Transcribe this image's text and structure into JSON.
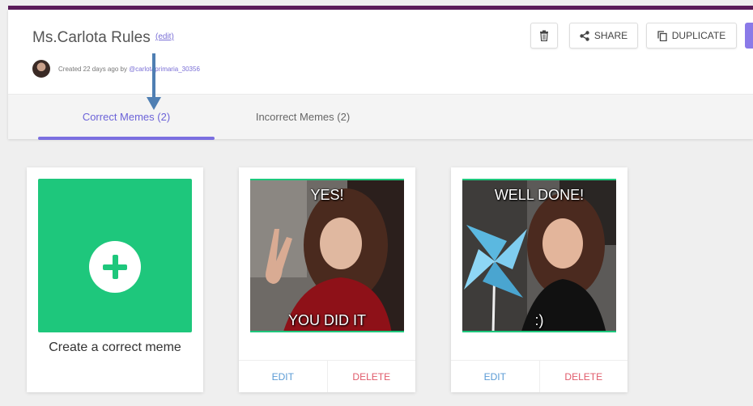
{
  "header": {
    "title": "Ms.Carlota Rules",
    "edit_label": "(edit)",
    "created_prefix": "Created 22 days ago by ",
    "username": "@carlotaprimaria_30356"
  },
  "toolbar": {
    "share_label": "SHARE",
    "duplicate_label": "DUPLICATE"
  },
  "tabs": [
    {
      "label": "Correct Memes (2)",
      "active": true
    },
    {
      "label": "Incorrect Memes (2)",
      "active": false
    }
  ],
  "create_card": {
    "label": "Create a correct meme"
  },
  "memes": [
    {
      "top_text": "YES!",
      "bottom_text": "YOU DID IT",
      "edit_label": "EDIT",
      "delete_label": "DELETE"
    },
    {
      "top_text": "WELL DONE!",
      "bottom_text": ":)",
      "edit_label": "EDIT",
      "delete_label": "DELETE"
    }
  ],
  "colors": {
    "accent": "#7b6fe0",
    "create_tile": "#1ec77c",
    "delete": "#e05a6a",
    "edit": "#5b9bd5",
    "top_bar": "#5b1d5a"
  },
  "icons": [
    "trash-icon",
    "share-icon",
    "duplicate-icon",
    "plus-icon",
    "arrow-down-icon"
  ]
}
